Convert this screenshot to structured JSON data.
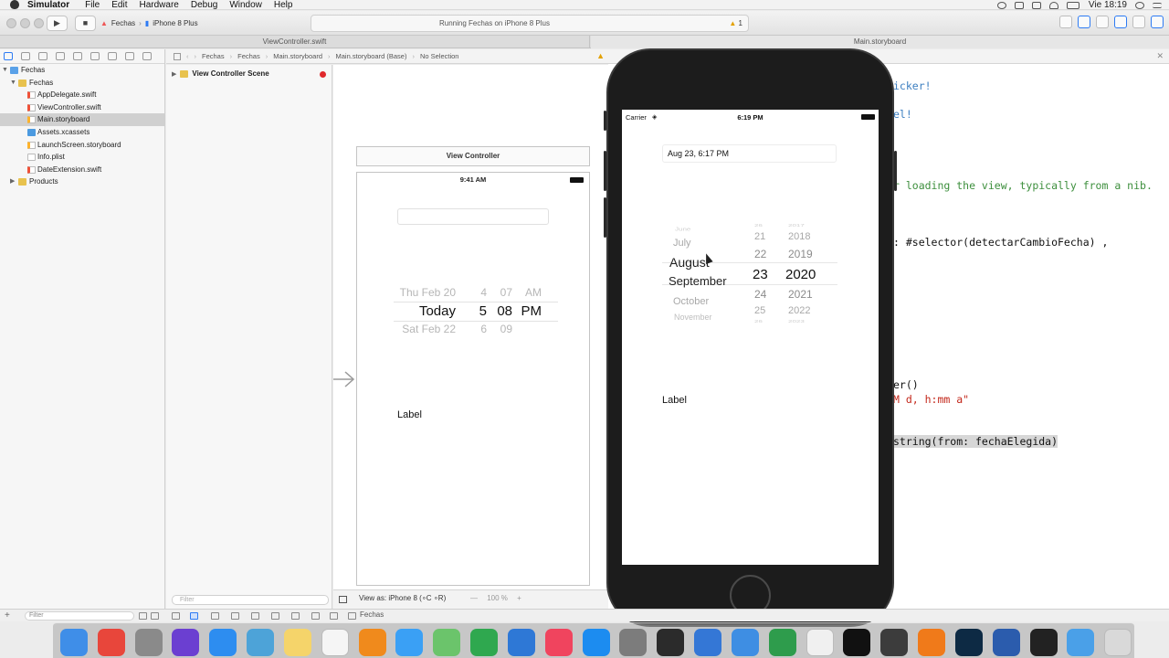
{
  "menubar": {
    "app": "Simulator",
    "items": [
      "File",
      "Edit",
      "Hardware",
      "Debug",
      "Window",
      "Help"
    ],
    "clock": "Vie 18:19"
  },
  "toolbar": {
    "scheme_project": "Fechas",
    "scheme_device": "iPhone 8 Plus",
    "status": "Running Fechas on iPhone 8 Plus",
    "warnings": "1"
  },
  "tabs": [
    "ViewController.swift",
    "Main.storyboard"
  ],
  "navigator": {
    "project": "Fechas",
    "group": "Fechas",
    "files": [
      {
        "name": "AppDelegate.swift",
        "kind": "swift"
      },
      {
        "name": "ViewController.swift",
        "kind": "swift"
      },
      {
        "name": "Main.storyboard",
        "kind": "storyboard"
      },
      {
        "name": "Assets.xcassets",
        "kind": "assets"
      },
      {
        "name": "LaunchScreen.storyboard",
        "kind": "storyboard"
      },
      {
        "name": "Info.plist",
        "kind": "plist"
      },
      {
        "name": "DateExtension.swift",
        "kind": "swift"
      }
    ],
    "products": "Products",
    "filter_placeholder": "Filter"
  },
  "jumpbar": [
    "Fechas",
    "Fechas",
    "Main.storyboard",
    "Main.storyboard (Base)",
    "No Selection"
  ],
  "outline": {
    "scene": "View Controller Scene",
    "filter_placeholder": "Filter"
  },
  "canvas": {
    "vc_title": "View Controller",
    "status_time": "9:41 AM",
    "picker_rows": [
      {
        "day": "Thu Feb 20",
        "hour": "4",
        "min": "07",
        "ampm": "AM"
      },
      {
        "day": "Today",
        "hour": "5",
        "min": "08",
        "ampm": "PM"
      },
      {
        "day": "Sat Feb 22",
        "hour": "6",
        "min": "09",
        "ampm": ""
      }
    ],
    "label": "Label",
    "view_as": "View as: iPhone 8 (∘C ∘R)",
    "zoom_minus": "—",
    "zoom": "100 %",
    "zoom_plus": "+"
  },
  "editor": {
    "lines": [
      {
        "text": "icker!",
        "cls": "kw-blue"
      },
      {
        "text": "el!",
        "cls": "kw-blue"
      },
      {
        "text": "r loading the view, typically from a nib.",
        "cls": "cm-green"
      },
      {
        "text": ": #selector(detectarCambioFecha) ,",
        "cls": "plain"
      },
      {
        "text": "er()",
        "cls": "plain"
      },
      {
        "text": "M d, h:mm a\"",
        "cls": "str-red"
      },
      {
        "text": "string(from: fechaElegida)",
        "cls": "plain"
      }
    ]
  },
  "simulator": {
    "carrier": "Carrier",
    "time": "6:19 PM",
    "date_field": "Aug 23, 6:17 PM",
    "months": [
      "June",
      "July",
      "August",
      "September",
      "October",
      "November"
    ],
    "days": [
      "26",
      "21",
      "22",
      "23",
      "24",
      "25",
      "26"
    ],
    "years": [
      "2017",
      "2018",
      "2019",
      "2020",
      "2021",
      "2022",
      "2023"
    ],
    "label": "Label"
  },
  "debugbar": {
    "filter_placeholder": "Filter",
    "process": "Fechas"
  },
  "dock": {
    "apps": [
      "finder-icon",
      "chrome-icon",
      "launchpad-icon",
      "siri-icon",
      "safari-icon",
      "preview-icon",
      "notes-icon",
      "reminders-icon",
      "books-icon",
      "messages-icon",
      "maps-icon",
      "numbers-icon",
      "keynote-icon",
      "music-icon",
      "appstore-icon",
      "system-preferences-icon",
      "quicktime-icon",
      "xcode-icon",
      "simulator-icon",
      "camtasia-icon",
      "textedit-icon",
      "intellij-icon",
      "atom-icon",
      "illustrator-icon",
      "photoshop-icon",
      "word-icon",
      "terminal-icon",
      "downloads-folder-icon",
      "trash-icon"
    ],
    "colors": [
      "#3f8ee8",
      "#e8463b",
      "#8a8a8a",
      "#6b3fd1",
      "#2d8df0",
      "#4da3d8",
      "#f5d46a",
      "#f5f5f5",
      "#f08a1c",
      "#3aa0f5",
      "#6bc46b",
      "#2fa84f",
      "#2e78d6",
      "#f0445e",
      "#1c8cf0",
      "#7c7c7c",
      "#2b2b2b",
      "#3477d6",
      "#3e8ee3",
      "#2e9c4c",
      "#f0f0f0",
      "#111111",
      "#3c3c3c",
      "#f07a1a",
      "#0d2a44",
      "#2b5cad",
      "#222222",
      "#4aa0e8",
      "#d9d9d9"
    ]
  },
  "accent_color": "#2d7bf4"
}
